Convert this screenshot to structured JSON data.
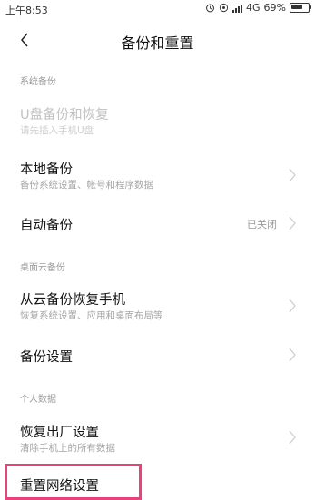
{
  "status_bar": {
    "time": "上午8:53",
    "network": "4G",
    "battery": "69%",
    "battery_level": 0.69
  },
  "header": {
    "title": "备份和重置",
    "back_icon": "back-chevron-icon"
  },
  "sections": {
    "system_backup": "系统备份",
    "desktop_cloud_backup": "桌面云备份",
    "personal_data": "个人数据"
  },
  "items": {
    "usb_backup": {
      "title": "U盘备份和恢复",
      "subtitle": "请先插入手机U盘"
    },
    "local_backup": {
      "title": "本地备份",
      "subtitle": "备份系统设置、帐号和程序数据"
    },
    "auto_backup": {
      "title": "自动备份",
      "value": "已关闭"
    },
    "cloud_restore": {
      "title": "从云备份恢复手机",
      "subtitle": "恢复系统设置、应用和桌面布局等"
    },
    "backup_settings": {
      "title": "备份设置"
    },
    "factory_reset": {
      "title": "恢复出厂设置",
      "subtitle": "清除手机上的所有数据"
    },
    "reset_network": {
      "title": "重置网络设置"
    }
  },
  "colors": {
    "highlight": "#e8417b",
    "secondary_text": "#a6a6a6",
    "disabled_text": "#c2c2c2"
  }
}
